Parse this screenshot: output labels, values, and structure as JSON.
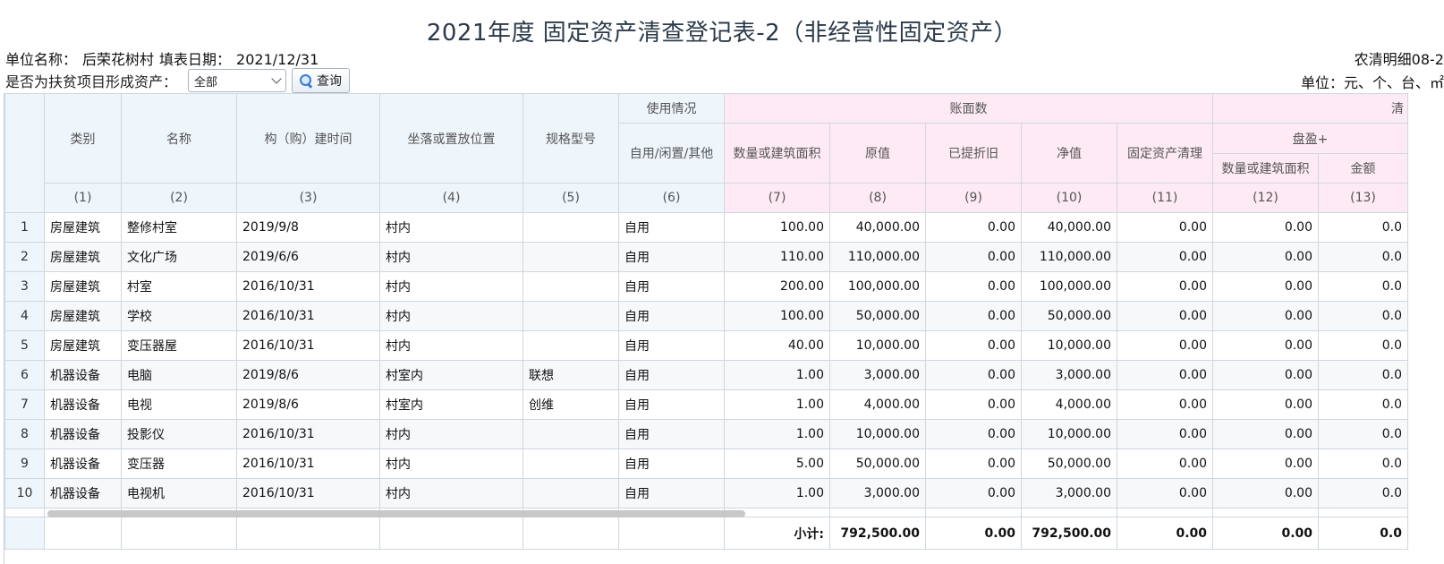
{
  "title": "2021年度 固定资产清查登记表-2（非经营性固定资产）",
  "meta": {
    "unit_label": "单位名称：",
    "unit_value": "后荣花树村",
    "date_label": "填表日期：",
    "date_value": "2021/12/31",
    "form_code": "农清明细08-2",
    "unit_note": "单位：元、个、台、㎡"
  },
  "filter": {
    "label": "是否为扶贫项目形成资产：",
    "selected": "全部",
    "query_label": "查询"
  },
  "headers": {
    "category": "类别",
    "name": "名称",
    "build_time": "构（购）建时间",
    "location": "坐落或置放位置",
    "spec": "规格型号",
    "usage_group": "使用情况",
    "usage": "自用/闲置/其他",
    "book_group": "账面数",
    "quantity": "数量或建筑面积",
    "original": "原值",
    "depreciation": "已提折旧",
    "net": "净值",
    "cleanup": "固定资产清理",
    "check_group": "清",
    "surplus_group": "盘盈+",
    "surplus_qty": "数量或建筑面积",
    "surplus_amount": "金额"
  },
  "index_labels": [
    "(1)",
    "(2)",
    "(3)",
    "(4)",
    "(5)",
    "(6)",
    "(7)",
    "(8)",
    "(9)",
    "(10)",
    "(11)",
    "(12)",
    "(13)"
  ],
  "rows": [
    {
      "no": "1",
      "category": "房屋建筑",
      "name": "整修村室",
      "time": "2019/9/8",
      "location": "村内",
      "spec": "",
      "usage": "自用",
      "qty": "100.00",
      "original": "40,000.00",
      "dep": "0.00",
      "net": "40,000.00",
      "clean": "0.00",
      "sq": "0.00",
      "sa": "0.0"
    },
    {
      "no": "2",
      "category": "房屋建筑",
      "name": "文化广场",
      "time": "2019/6/6",
      "location": "村内",
      "spec": "",
      "usage": "自用",
      "qty": "110.00",
      "original": "110,000.00",
      "dep": "0.00",
      "net": "110,000.00",
      "clean": "0.00",
      "sq": "0.00",
      "sa": "0.0"
    },
    {
      "no": "3",
      "category": "房屋建筑",
      "name": "村室",
      "time": "2016/10/31",
      "location": "村内",
      "spec": "",
      "usage": "自用",
      "qty": "200.00",
      "original": "100,000.00",
      "dep": "0.00",
      "net": "100,000.00",
      "clean": "0.00",
      "sq": "0.00",
      "sa": "0.0"
    },
    {
      "no": "4",
      "category": "房屋建筑",
      "name": "学校",
      "time": "2016/10/31",
      "location": "村内",
      "spec": "",
      "usage": "自用",
      "qty": "100.00",
      "original": "50,000.00",
      "dep": "0.00",
      "net": "50,000.00",
      "clean": "0.00",
      "sq": "0.00",
      "sa": "0.0"
    },
    {
      "no": "5",
      "category": "房屋建筑",
      "name": "变压器屋",
      "time": "2016/10/31",
      "location": "村内",
      "spec": "",
      "usage": "自用",
      "qty": "40.00",
      "original": "10,000.00",
      "dep": "0.00",
      "net": "10,000.00",
      "clean": "0.00",
      "sq": "0.00",
      "sa": "0.0"
    },
    {
      "no": "6",
      "category": "机器设备",
      "name": "电脑",
      "time": "2019/8/6",
      "location": "村室内",
      "spec": "联想",
      "usage": "自用",
      "qty": "1.00",
      "original": "3,000.00",
      "dep": "0.00",
      "net": "3,000.00",
      "clean": "0.00",
      "sq": "0.00",
      "sa": "0.0"
    },
    {
      "no": "7",
      "category": "机器设备",
      "name": "电视",
      "time": "2019/8/6",
      "location": "村室内",
      "spec": "创维",
      "usage": "自用",
      "qty": "1.00",
      "original": "4,000.00",
      "dep": "0.00",
      "net": "4,000.00",
      "clean": "0.00",
      "sq": "0.00",
      "sa": "0.0"
    },
    {
      "no": "8",
      "category": "机器设备",
      "name": "投影仪",
      "time": "2016/10/31",
      "location": "村内",
      "spec": "",
      "usage": "自用",
      "qty": "1.00",
      "original": "10,000.00",
      "dep": "0.00",
      "net": "10,000.00",
      "clean": "0.00",
      "sq": "0.00",
      "sa": "0.0"
    },
    {
      "no": "9",
      "category": "机器设备",
      "name": "变压器",
      "time": "2016/10/31",
      "location": "村内",
      "spec": "",
      "usage": "自用",
      "qty": "5.00",
      "original": "50,000.00",
      "dep": "0.00",
      "net": "50,000.00",
      "clean": "0.00",
      "sq": "0.00",
      "sa": "0.0"
    },
    {
      "no": "10",
      "category": "机器设备",
      "name": "电视机",
      "time": "2016/10/31",
      "location": "村内",
      "spec": "",
      "usage": "自用",
      "qty": "1.00",
      "original": "3,000.00",
      "dep": "0.00",
      "net": "3,000.00",
      "clean": "0.00",
      "sq": "0.00",
      "sa": "0.0"
    }
  ],
  "totals": {
    "label": "小计:",
    "original": "792,500.00",
    "dep": "0.00",
    "net": "792,500.00",
    "clean": "0.00",
    "sq": "0.00",
    "sa": "0.0"
  }
}
